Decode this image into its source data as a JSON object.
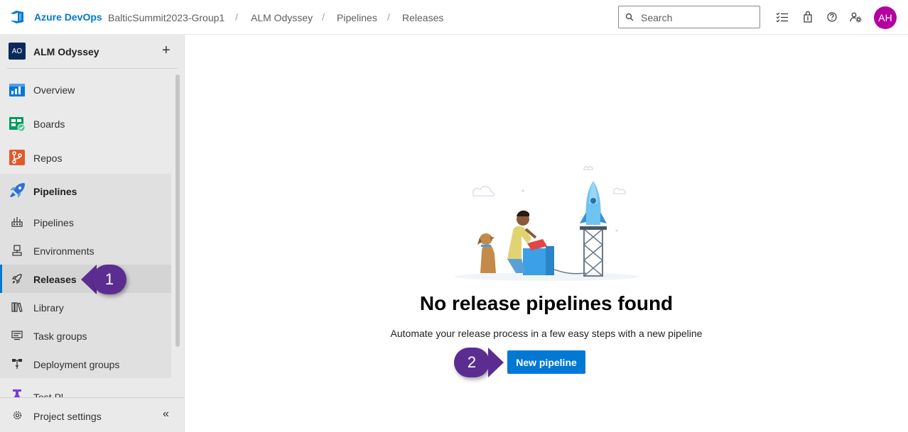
{
  "header": {
    "brand": "Azure DevOps",
    "breadcrumbs": [
      "BalticSummit2023-Group1",
      "ALM Odyssey",
      "Pipelines",
      "Releases"
    ],
    "search_placeholder": "Search",
    "avatar_initials": "AH"
  },
  "sidebar": {
    "project_badge": "AO",
    "project_name": "ALM Odyssey",
    "items": [
      {
        "label": "Overview"
      },
      {
        "label": "Boards"
      },
      {
        "label": "Repos"
      },
      {
        "label": "Pipelines"
      }
    ],
    "sub_items": [
      {
        "label": "Pipelines"
      },
      {
        "label": "Environments"
      },
      {
        "label": "Releases"
      },
      {
        "label": "Library"
      },
      {
        "label": "Task groups"
      },
      {
        "label": "Deployment groups"
      },
      {
        "label": "Test Pl"
      }
    ],
    "settings_label": "Project settings"
  },
  "callouts": {
    "one": "1",
    "two": "2"
  },
  "main": {
    "title": "No release pipelines found",
    "description": "Automate your release process in a few easy steps with a new pipeline",
    "button_label": "New pipeline"
  },
  "colors": {
    "accent": "#0078d4",
    "callout": "#5c2d91",
    "avatar": "#b4009e",
    "project_badge": "#0a2a5b"
  }
}
